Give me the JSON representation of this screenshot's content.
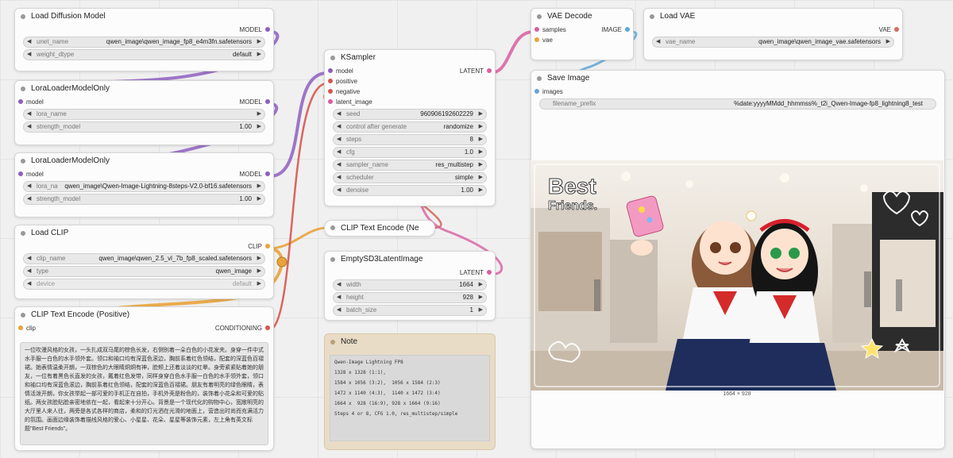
{
  "nodes": {
    "load_diffusion": {
      "title": "Load Diffusion Model",
      "output": "MODEL",
      "widgets": [
        {
          "label": "unet_name",
          "value": "qwen_image\\qwen_image_fp8_e4m3fn.safetensors"
        },
        {
          "label": "weight_dtype",
          "value": "default"
        }
      ]
    },
    "lora1": {
      "title": "LoraLoaderModelOnly",
      "input": "model",
      "output": "MODEL",
      "widgets": [
        {
          "label": "lora_name",
          "value": ""
        },
        {
          "label": "strength_model",
          "value": "1.00"
        }
      ]
    },
    "lora2": {
      "title": "LoraLoaderModelOnly",
      "input": "model",
      "output": "MODEL",
      "widgets": [
        {
          "label": "lora_na",
          "value": "qwen_image\\Qwen-Image-Lightning-8steps-V2.0-bf16.safetensors"
        },
        {
          "label": "strength_model",
          "value": "1.00"
        }
      ]
    },
    "load_clip": {
      "title": "Load CLIP",
      "output": "CLIP",
      "widgets": [
        {
          "label": "clip_name",
          "value": "qwen_image\\qwen_2.5_vl_7b_fp8_scaled.safetensors"
        },
        {
          "label": "type",
          "value": "qwen_image"
        },
        {
          "label": "device",
          "value": "default"
        }
      ]
    },
    "clip_pos": {
      "title": "CLIP Text Encode (Positive)",
      "input": "clip",
      "output": "CONDITIONING",
      "text": "一位吹漫风格的女孩，一头扎成双马尾的棕色长发，右侧别着一朵白色的小花发夹。身穿一件中式水手服一白色的水手领外套。领口和袖口均有深蓝色滚边，胸前系着红色领结，配套的深蓝色百褶裙。她表情温柔开朗，一双棕色的大眼睛炯炯有神，脸颊上还着淡淡的红晕。身旁紧紧贴着她的朋友，一位有着黑色长直发的女孩，戴着红色发带，同样身穿白色水手服一白色的水手领外套，领口和袖口均有深蓝色滚边，胸前系着红色领结，配套的深蓝色百褶裙。朋友有着明亮的绿色眼睛，表情活泼开朗，你女孩举起一部可爱的手机正在自拍，手机外壳是粉色的，装饰着小花朵和可爱的贴纸。两女孩脸贴脸亲密地依在一起，看起来十分开心。背景是一个现代化的购物中心，宽敞明亮的大厅里人来人往，两旁是各式各样的商店，柔和的灯光洒在光滑的地面上，营造出时尚而充满活力的氛围。画面边缘装饰着描线风格的爱心、小星星、花朵、星星等装饰元素，左上角有英文标题\"Best Friends\"。"
    },
    "ksampler": {
      "title": "KSampler",
      "inputs": [
        "model",
        "positive",
        "negative",
        "latent_image"
      ],
      "output": "LATENT",
      "widgets": [
        {
          "label": "seed",
          "value": "960906192602229"
        },
        {
          "label": "control after generate",
          "value": "randomize"
        },
        {
          "label": "steps",
          "value": "8"
        },
        {
          "label": "cfg",
          "value": "1.0"
        },
        {
          "label": "sampler_name",
          "value": "res_multistep"
        },
        {
          "label": "scheduler",
          "value": "simple"
        },
        {
          "label": "denoise",
          "value": "1.00"
        }
      ]
    },
    "clip_neg": {
      "title": "CLIP Text Encode (Ne"
    },
    "empty_latent": {
      "title": "EmptySD3LatentImage",
      "output": "LATENT",
      "widgets": [
        {
          "label": "width",
          "value": "1664"
        },
        {
          "label": "height",
          "value": "928"
        },
        {
          "label": "batch_size",
          "value": "1"
        }
      ]
    },
    "note": {
      "title": "Note",
      "lines": [
        "Qwen-Image Lightning FP8",
        "1328 x 1328 (1:1),",
        "1584 x 1056 (3:2),  1056 x 1584 (2:3)",
        "1472 x 1140 (4:3),  1140 x 1472 (3:4)",
        "1664 x  928 (16:9), 928 x 1664 (9:16)",
        "Steps 4 or 8, CFG 1.0, res_multistep/simple"
      ]
    },
    "vae_decode": {
      "title": "VAE Decode",
      "inputs": [
        "samples",
        "vae"
      ],
      "output": "IMAGE"
    },
    "load_vae": {
      "title": "Load VAE",
      "output": "VAE",
      "widgets": [
        {
          "label": "vae_name",
          "value": "qwen_image\\qwen_image_vae.safetensors"
        }
      ]
    },
    "save_image": {
      "title": "Save Image",
      "input": "images",
      "widgets": [
        {
          "label": "filename_prefix",
          "value": "%date:yyyyMMdd_hhmmss%_t2i_Qwen-Image-fp8_lightning8_test"
        }
      ],
      "image_title": "Best Friends.",
      "image_size": "1664 × 928"
    }
  },
  "colors": {
    "model": "#8e5fbf",
    "clip": "#e9a33b",
    "conditioning": "#d6564e",
    "latent": "#d85fa0",
    "vae": "#d66b5b",
    "image": "#5fa7d6"
  }
}
